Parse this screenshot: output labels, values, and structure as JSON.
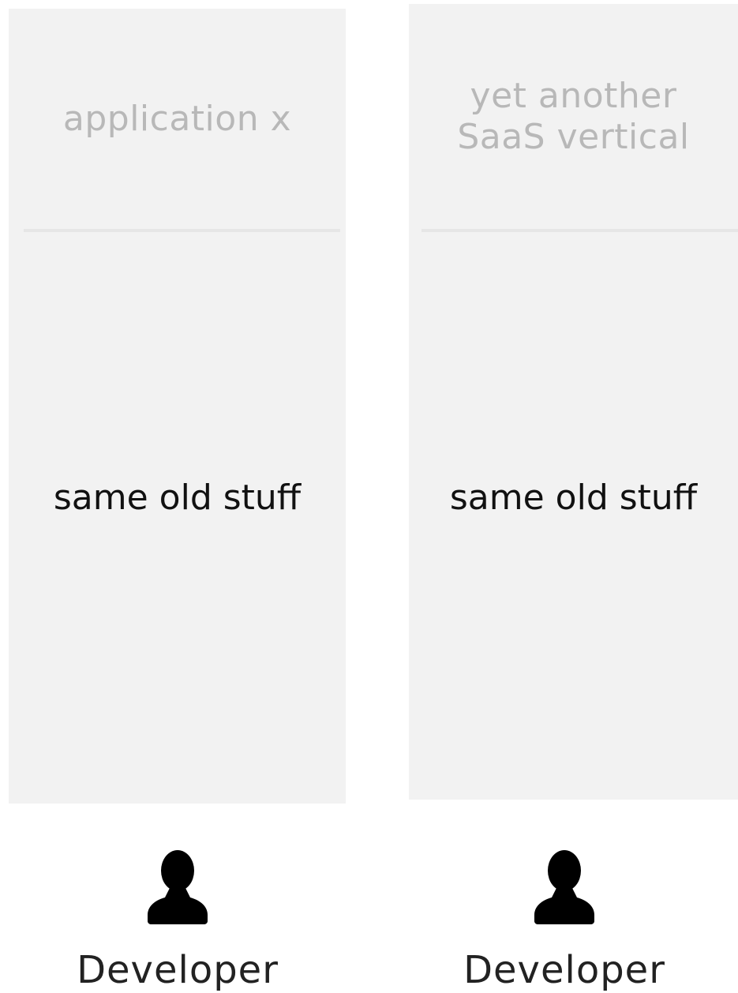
{
  "columns": [
    {
      "header": "application x",
      "body": "same old stuff",
      "persona": {
        "icon": "user-icon",
        "label": "Developer"
      }
    },
    {
      "header": "yet another SaaS vertical",
      "body": "same old stuff",
      "persona": {
        "icon": "user-icon",
        "label": "Developer"
      }
    }
  ],
  "colors": {
    "card_background": "#f2f2f2",
    "header_text": "#b8b8b8",
    "body_text": "#111111",
    "icon": "#000000"
  }
}
